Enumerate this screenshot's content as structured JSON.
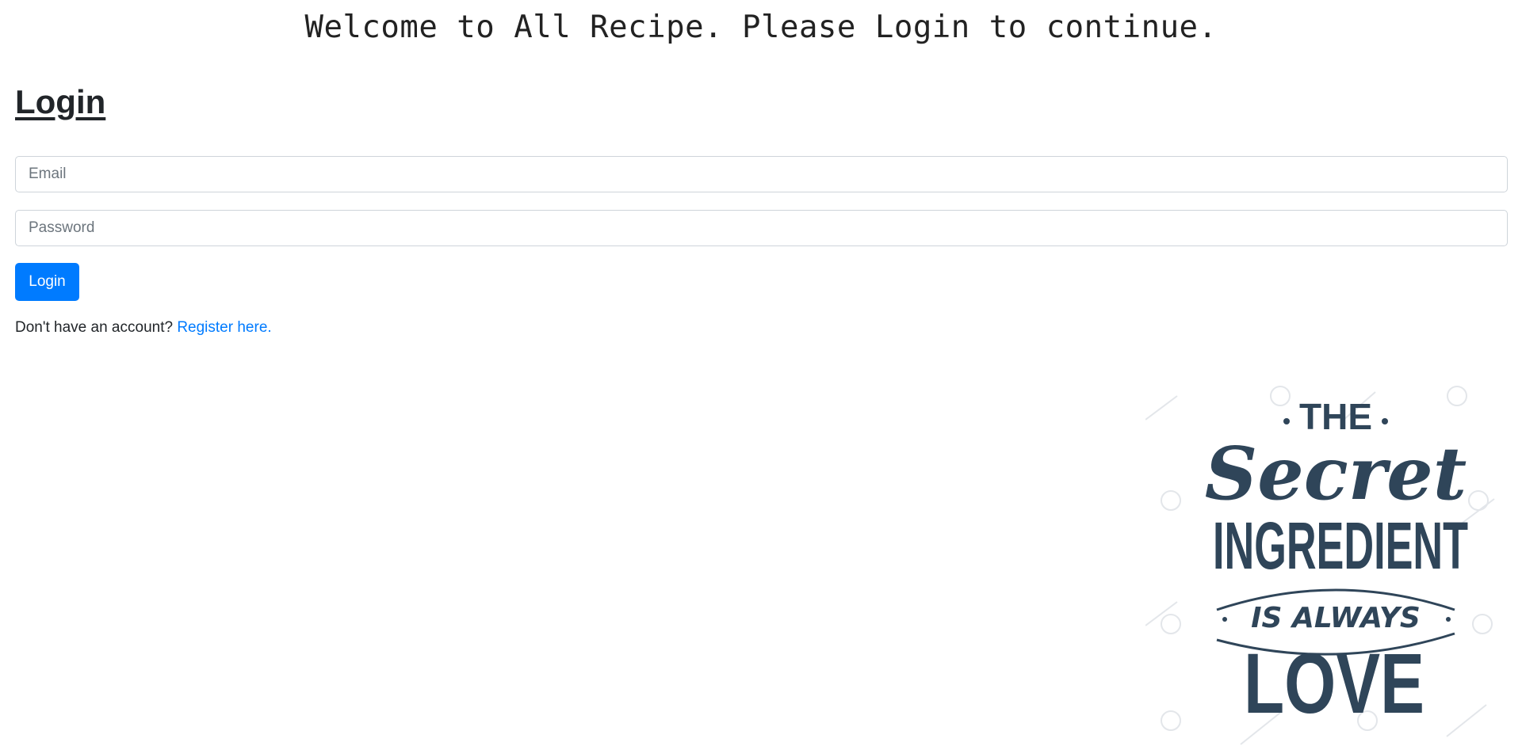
{
  "header": {
    "welcome_text": "Welcome to All Recipe. Please Login to continue."
  },
  "login_form": {
    "title": "Login",
    "email_placeholder": "Email",
    "password_placeholder": "Password",
    "submit_label": "Login",
    "no_account_text": "Don't have an account? ",
    "register_link_text": "Register here."
  },
  "artwork": {
    "icon": "lettering-illustration",
    "color": "#2f4559",
    "lines": [
      "THE",
      "Secret",
      "INGREDIENT",
      "IS ALWAYS",
      "LOVE"
    ]
  },
  "colors": {
    "primary": "#007bff",
    "text": "#212529"
  }
}
